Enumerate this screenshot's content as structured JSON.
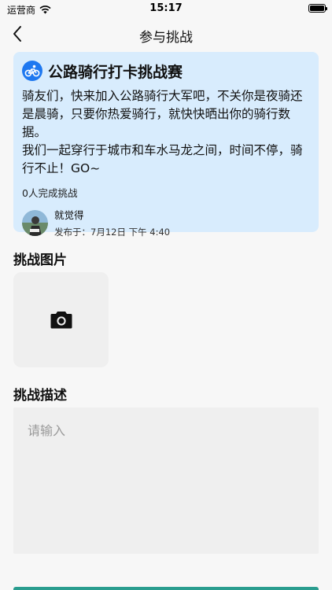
{
  "status_bar": {
    "carrier": "运营商",
    "time": "15:17"
  },
  "nav": {
    "title": "参与挑战"
  },
  "challenge": {
    "title": "公路骑行打卡挑战赛",
    "description_lines": [
      "骑友们，快来加入公路骑行大军吧，不关你是夜骑还是晨骑，只要你热爱骑行，就快快晒出你的骑行数据。",
      "我们一起穿行于城市和车水马龙之间，时间不停，骑行不止！GO~"
    ],
    "completion": "0人完成挑战",
    "author": {
      "name": "就觉得",
      "published": "发布于：7月12日 下午 4:40"
    }
  },
  "photo_section": {
    "title": "挑战图片"
  },
  "description_section": {
    "title": "挑战描述",
    "placeholder": "请输入",
    "value": ""
  },
  "colors": {
    "card_background": "#d8ecfd",
    "badge_blue": "#1e78f0",
    "bottom_accent": "#2a9d8f"
  },
  "icons": {
    "back": "chevron-left-icon",
    "badge": "cycling-icon",
    "camera": "camera-icon",
    "wifi": "wifi-icon",
    "battery": "battery-icon"
  }
}
